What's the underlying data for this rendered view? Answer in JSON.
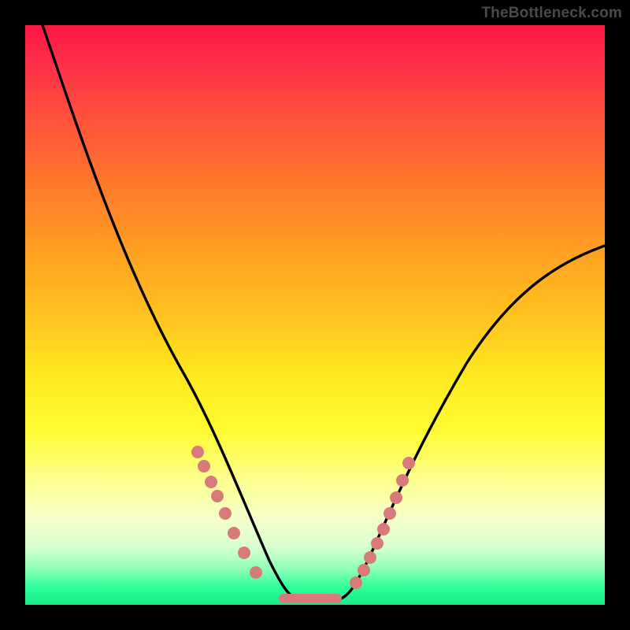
{
  "watermark": "TheBottleneck.com",
  "chart_data": {
    "type": "line",
    "title": "",
    "xlabel": "",
    "ylabel": "",
    "xlim": [
      0,
      100
    ],
    "ylim": [
      0,
      100
    ],
    "series": [
      {
        "name": "bottleneck-curve",
        "x": [
          3,
          8,
          14,
          20,
          25,
          27,
          29,
          31,
          33,
          35,
          37,
          39,
          41,
          43,
          44.5,
          46,
          48,
          50,
          52,
          54,
          56,
          58,
          60,
          63,
          66,
          70,
          75,
          80,
          85,
          90,
          95,
          100
        ],
        "y": [
          100,
          86,
          69,
          52,
          38,
          33,
          27,
          23,
          19,
          15,
          12,
          9,
          6,
          4,
          2.5,
          1.5,
          1,
          1,
          1,
          1.5,
          2.5,
          4,
          6,
          10,
          15,
          22,
          30,
          38,
          45,
          52,
          57,
          62
        ]
      }
    ],
    "markers": {
      "left_cluster": [
        [
          29,
          27
        ],
        [
          30,
          24
        ],
        [
          31,
          22
        ],
        [
          32,
          19
        ],
        [
          33,
          16
        ],
        [
          34.5,
          13
        ],
        [
          36,
          10
        ],
        [
          38,
          7
        ]
      ],
      "right_cluster": [
        [
          57,
          3
        ],
        [
          58,
          5
        ],
        [
          59,
          7
        ],
        [
          60,
          9
        ],
        [
          61,
          11
        ],
        [
          62,
          14
        ],
        [
          63,
          17
        ],
        [
          64,
          20
        ],
        [
          65,
          23
        ]
      ],
      "bottom_bar": [
        [
          44,
          1
        ],
        [
          46,
          1
        ],
        [
          48,
          1
        ],
        [
          50,
          1
        ],
        [
          52,
          1
        ],
        [
          54,
          1
        ]
      ]
    },
    "marker_color": "#d97a7a",
    "curve_color": "#000000"
  }
}
